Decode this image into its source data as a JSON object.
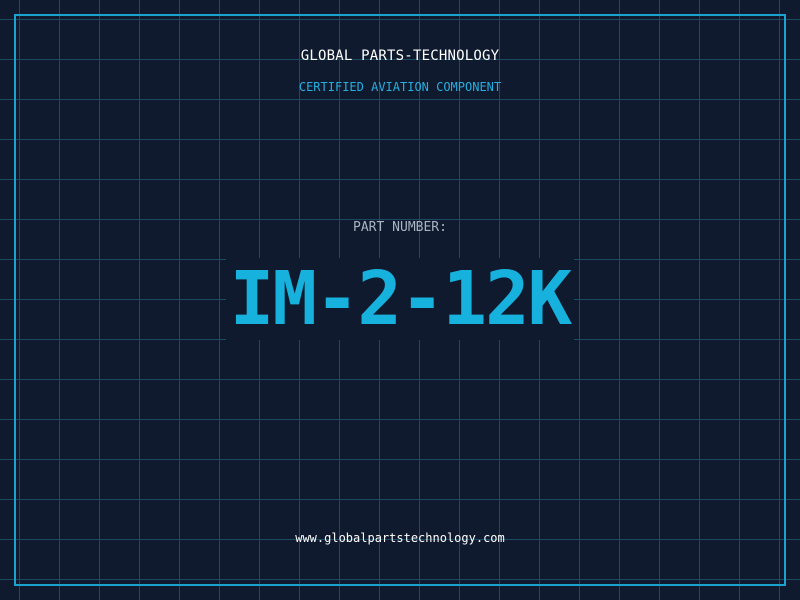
{
  "header": {
    "brand": "GLOBAL PARTS-TECHNOLOGY",
    "subtitle": "CERTIFIED AVIATION COMPONENT"
  },
  "part": {
    "label": "PART NUMBER:",
    "number": "IM-2-12K"
  },
  "footer": {
    "website": "www.globalpartstechnology.com"
  },
  "colors": {
    "background": "#0f1a2e",
    "grid": "#1d4a63",
    "accent": "#16b2dd",
    "text": "#ffffff",
    "muted": "#a8b4c4"
  }
}
